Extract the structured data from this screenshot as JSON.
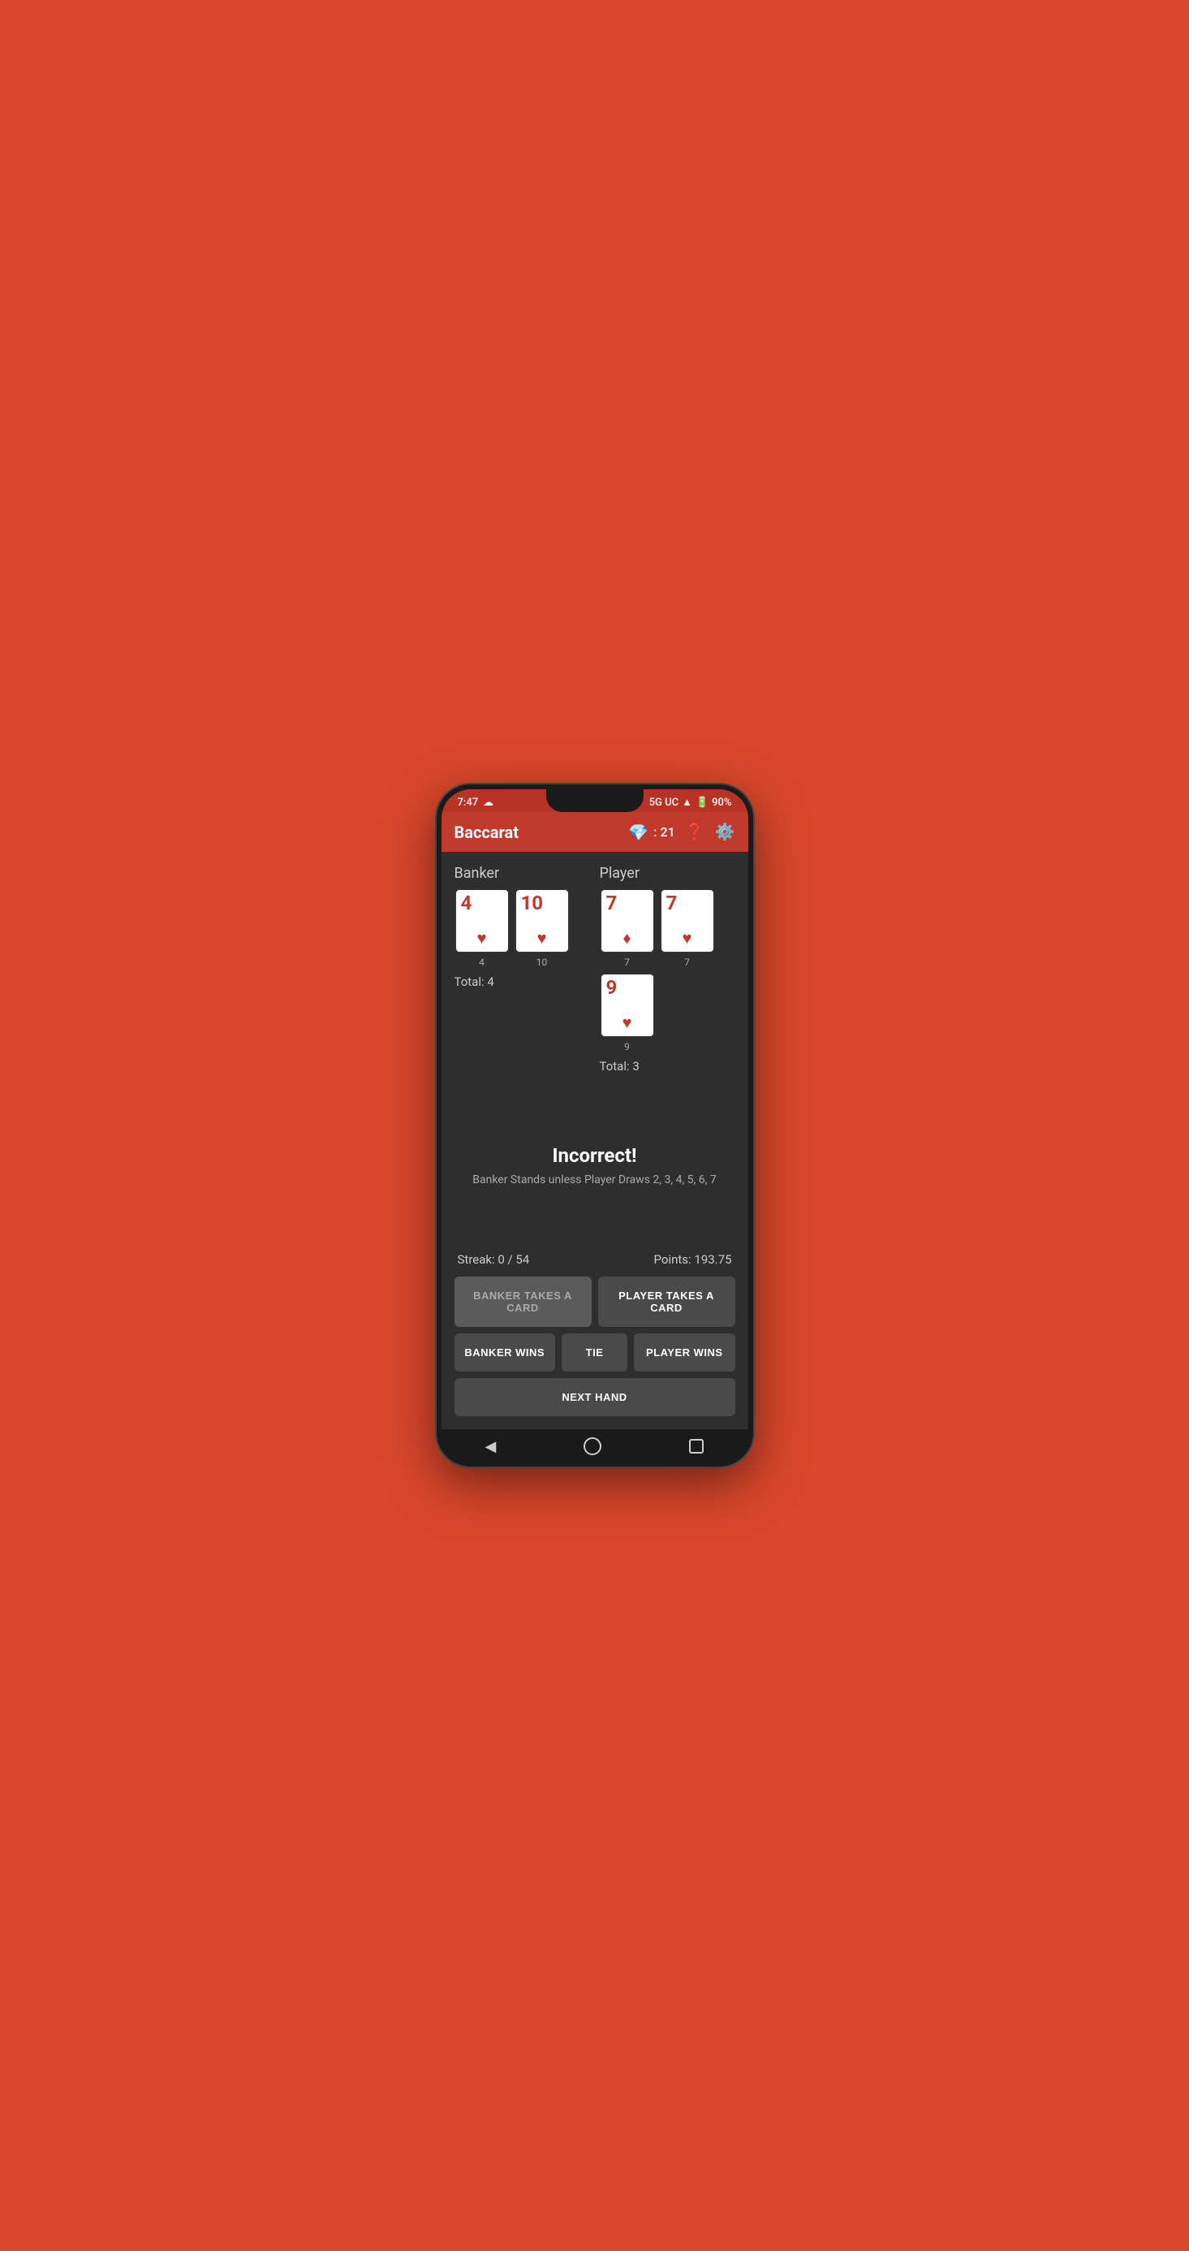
{
  "status_bar": {
    "time": "7:47",
    "network": "5G UC",
    "battery": "90%"
  },
  "app_bar": {
    "title": "Baccarat",
    "gem_score": "21",
    "help_label": "?",
    "settings_label": "⚙"
  },
  "banker": {
    "label": "Banker",
    "cards": [
      {
        "value": "4",
        "suit": "♥",
        "type": "heart",
        "label": "4"
      },
      {
        "value": "10",
        "suit": "♥",
        "type": "heart",
        "label": "10"
      }
    ],
    "total_label": "Total: 4"
  },
  "player": {
    "label": "Player",
    "cards": [
      {
        "value": "7",
        "suit": "♦",
        "type": "diamond",
        "label": "7"
      },
      {
        "value": "7",
        "suit": "♥",
        "type": "heart",
        "label": "7"
      },
      {
        "value": "9",
        "suit": "♥",
        "type": "heart",
        "label": "9"
      }
    ],
    "total_label": "Total: 3"
  },
  "feedback": {
    "title": "Incorrect!",
    "subtitle": "Banker Stands unless Player Draws 2, 3, 4, 5, 6, 7"
  },
  "stats": {
    "streak": "Streak: 0 / 54",
    "points": "Points: 193.75"
  },
  "buttons": {
    "banker_takes_card": "BANKER TAKES A CARD",
    "player_takes_card": "PLAYER TAKES A CARD",
    "banker_wins": "BANKER WINS",
    "tie": "TIE",
    "player_wins": "PLAYER WINS",
    "next_hand": "NEXT HAND"
  }
}
